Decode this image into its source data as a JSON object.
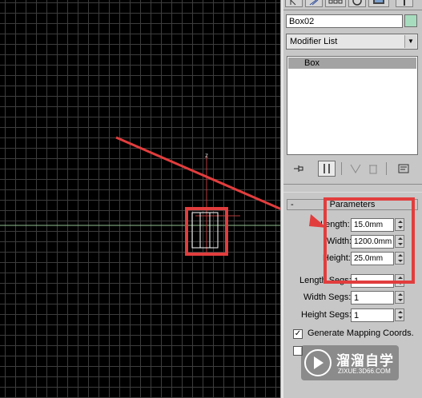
{
  "viewport": {
    "axis_label": "z"
  },
  "panel": {
    "object_name": "Box02",
    "object_color": "#a7dcbe",
    "modifier_list_label": "Modifier List",
    "stack_item": "Box",
    "tabs_icons": [
      "create-icon",
      "modify-icon",
      "hierarchy-icon",
      "motion-icon",
      "display-icon",
      "utilities-icon"
    ],
    "stack_tools": [
      "pin-stack-icon",
      "show-end-result-icon",
      "make-unique-icon",
      "remove-modifier-icon",
      "configure-modifier-sets-icon"
    ],
    "rollout": {
      "toggle": "-",
      "title": "Parameters",
      "length_label": "Length:",
      "length_value": "15.0mm",
      "width_label": "Width:",
      "width_value": "1200.0mm",
      "height_label": "Height:",
      "height_value": "25.0mm",
      "length_segs_label": "Length Segs:",
      "length_segs_value": "1",
      "width_segs_label": "Width Segs:",
      "width_segs_value": "1",
      "height_segs_label": "Height Segs:",
      "height_segs_value": "1",
      "gen_mapping_label": "Generate Mapping Coords.",
      "gen_mapping_checked": true,
      "real_world_checked": false
    }
  },
  "annotation": {
    "color": "#e23d3d"
  },
  "watermark": {
    "title": "溜溜自学",
    "url": "ZIXUE.3D66.COM"
  }
}
